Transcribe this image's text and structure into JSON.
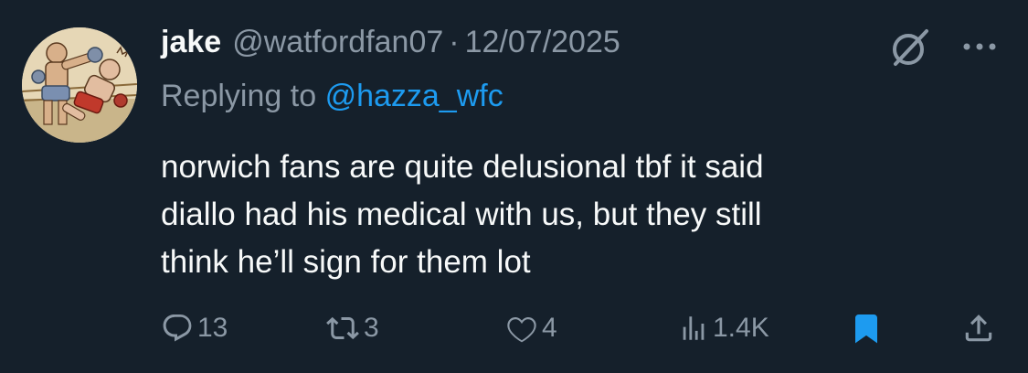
{
  "author": {
    "name": "jake",
    "handle": "@watfordfan07",
    "separator": "·",
    "date": "12/07/2025"
  },
  "reply": {
    "prefix": "Replying to",
    "mention": "@hazza_wfc"
  },
  "tweet": {
    "lines": [
      "norwich fans are quite delusional tbf it said",
      "diallo had his medical with us, but they still",
      "think he’ll sign for them lot"
    ]
  },
  "actions": {
    "reply_count": "13",
    "repost_count": "3",
    "like_count": "4",
    "view_count": "1.4K",
    "bookmarked": true
  },
  "icons": {
    "header": [
      "grok-icon",
      "more-icon"
    ],
    "action_bar": [
      "reply-icon",
      "repost-icon",
      "like-icon",
      "views-icon",
      "bookmark-icon",
      "share-icon"
    ]
  },
  "colors": {
    "background": "#15202b",
    "text_primary": "#f7f9f9",
    "text_secondary": "#8b98a5",
    "accent": "#1d9bf0"
  }
}
